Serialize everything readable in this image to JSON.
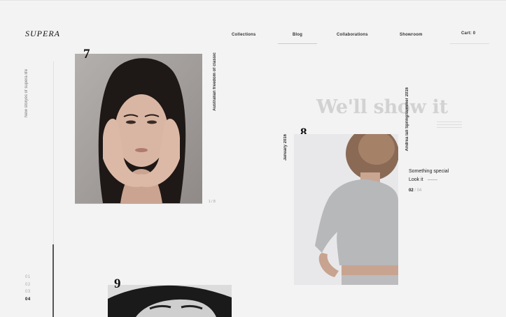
{
  "brand": {
    "logo_text": "SUPERA"
  },
  "nav": {
    "items": [
      "Collections",
      "Blog",
      "Collaborations",
      "Showroom"
    ],
    "cart_label": "Cart: 0"
  },
  "sidebar": {
    "tagline": "New storyes of supera life",
    "pages": [
      "01",
      "02",
      "03",
      "04"
    ],
    "active_page": "04"
  },
  "story7": {
    "number": "7",
    "caption": "Australian freedom of classic",
    "counter": "1 / 8"
  },
  "hero": {
    "headline": "We'll show it"
  },
  "story8": {
    "number": "8",
    "date": "January 2016",
    "caption": "Andrea lali Spring/summer 2016",
    "line1": "Something special",
    "line2": "Look it",
    "counter_current": "02",
    "counter_sep": "/",
    "counter_total": "04"
  },
  "story9": {
    "number": "9"
  },
  "colors": {
    "background": "#f3f3f3",
    "accent_line": "#d8c4c4",
    "headline": "#d2d2d2"
  }
}
